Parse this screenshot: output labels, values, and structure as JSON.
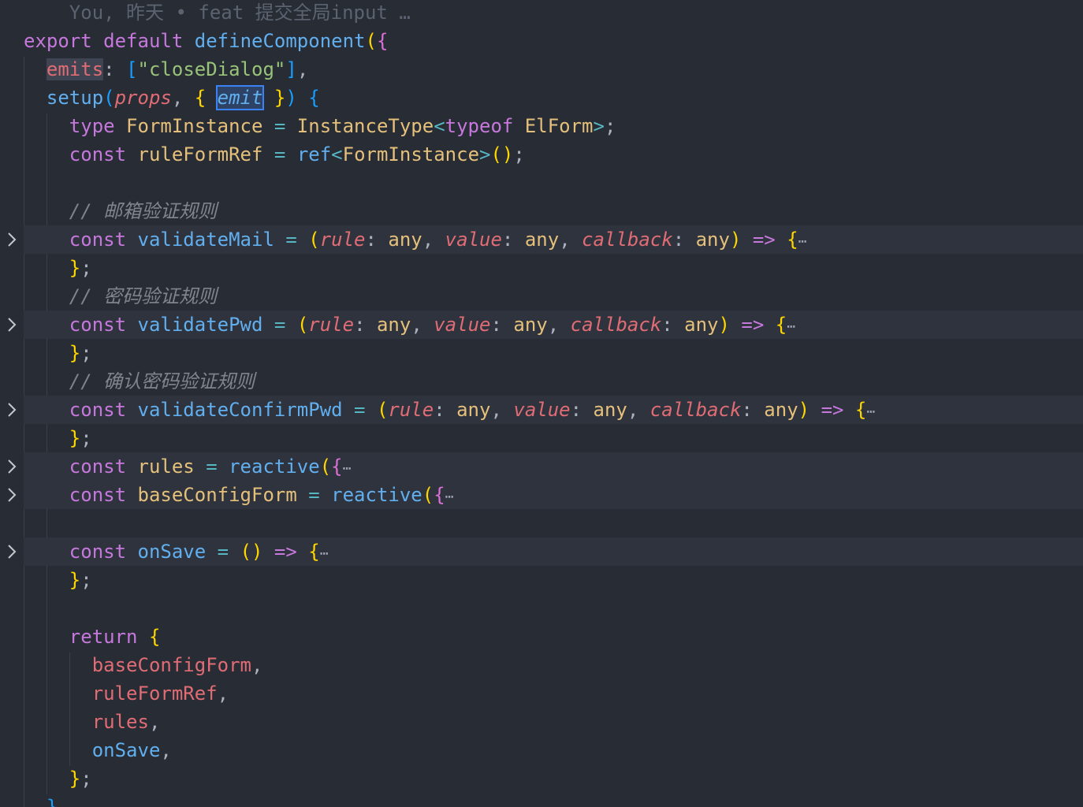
{
  "blame": {
    "text": "You, 昨天 • feat 提交全局input …"
  },
  "code": {
    "export": "export",
    "default": "default",
    "defineComponent": "defineComponent",
    "emits_key": "emits",
    "emits_value": "\"closeDialog\"",
    "setup": "setup",
    "props": "props",
    "emit": "emit",
    "type_kw": "type",
    "FormInstance": "FormInstance",
    "InstanceType": "InstanceType",
    "typeof_kw": "typeof",
    "ElForm": "ElForm",
    "const_kw": "const",
    "ruleFormRef": "ruleFormRef",
    "ref": "ref",
    "comment_mail": "// 邮箱验证规则",
    "validateMail": "validateMail",
    "comment_pwd": "// 密码验证规则",
    "validatePwd": "validatePwd",
    "comment_confirm": "// 确认密码验证规则",
    "validateConfirmPwd": "validateConfirmPwd",
    "rule": "rule",
    "value": "value",
    "callback": "callback",
    "any": "any",
    "rules": "rules",
    "reactive": "reactive",
    "baseConfigForm": "baseConfigForm",
    "onSave": "onSave",
    "return_kw": "return",
    "ellipsis": "⋯"
  }
}
